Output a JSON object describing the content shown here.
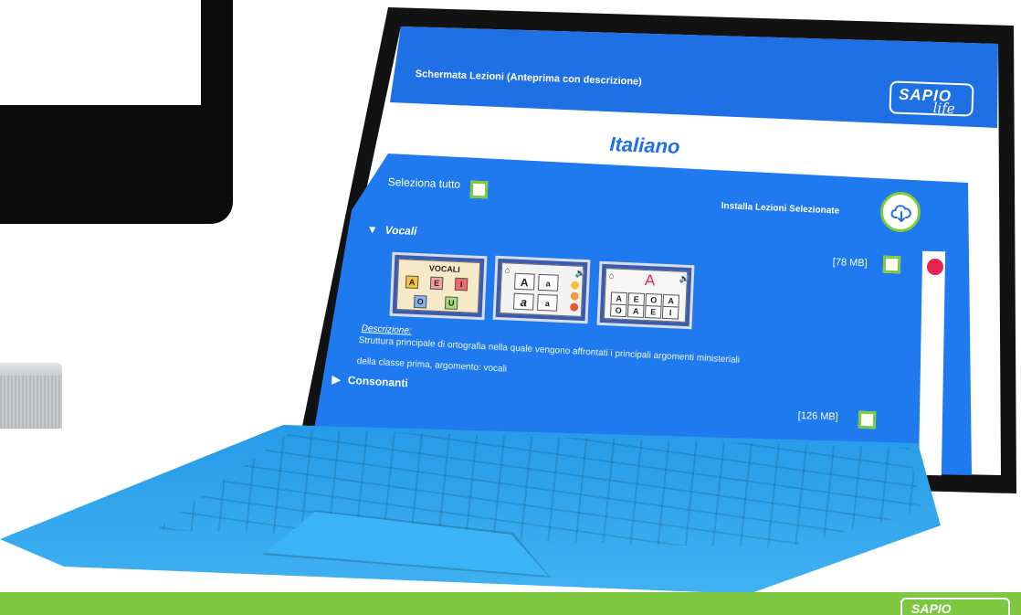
{
  "header": {
    "title": "Schermata Lezioni (Anteprima con descrizione)",
    "logo_main": "SAPIO",
    "logo_sub": "life"
  },
  "subject": "Italiano",
  "toolbar": {
    "select_all_label": "Seleziona tutto",
    "install_label": "Installa Lezioni Selezionate",
    "install_icon": "cloud-download-icon"
  },
  "sections": [
    {
      "name": "Vocali",
      "expanded": true,
      "size": "[78 MB]",
      "thumbnails": [
        {
          "title": "VOCALI",
          "tiles": [
            "A",
            "E",
            "I",
            "O",
            "U"
          ]
        },
        {
          "tiles": [
            "A",
            "a",
            "a",
            "a"
          ]
        },
        {
          "big_letter": "A",
          "row1": [
            "A",
            "E",
            "O",
            "A"
          ],
          "row2": [
            "O",
            "A",
            "E",
            "I"
          ]
        }
      ],
      "description_label": "Descrizione:",
      "description_line1": "Struttura principale di ortografia nella quale vengono affrontati i principali argomenti ministeriali",
      "description_line2": "della classe prima, argomento: vocali"
    },
    {
      "name": "Consonanti",
      "expanded": false,
      "size": "[126 MB]"
    }
  ],
  "footer": {
    "logo": "SAPIO"
  },
  "colors": {
    "primary_blue": "#1f6fe5",
    "checkbox_green": "#7dcb3a",
    "scroll_red": "#e8234f",
    "footer_green": "#7ec741",
    "keyboard_blue": "#27a9f5"
  }
}
